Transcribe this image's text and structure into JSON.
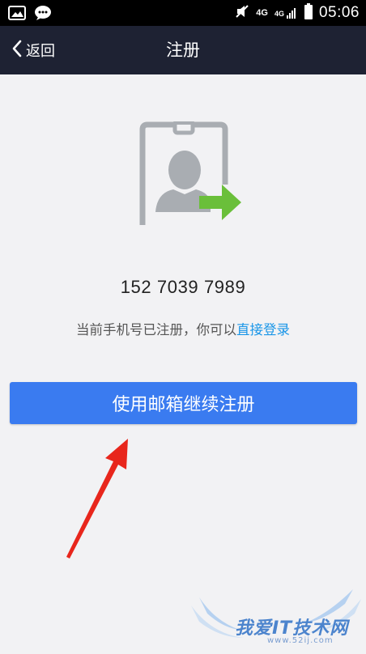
{
  "status_bar": {
    "time": "05:06",
    "network_1": "4G",
    "network_2": "4G",
    "icons": [
      "gallery-icon",
      "chat-bubble-icon",
      "mute-icon",
      "signal-icon",
      "battery-icon"
    ]
  },
  "header": {
    "back_label": "返回",
    "title": "注册"
  },
  "main": {
    "phone_number": "152 7039 7989",
    "hint_prefix": "当前手机号已注册，你可以",
    "hint_link": "直接登录",
    "continue_button": "使用邮箱继续注册"
  },
  "watermark": {
    "text": "我爱IT技术网",
    "url": "www.52ij.com"
  },
  "colors": {
    "header_bg": "#1e2233",
    "page_bg": "#f2f2f4",
    "primary_button": "#3a7bf0",
    "link": "#1a96e8",
    "illustration_gray": "#a9adb2",
    "illustration_green": "#6abf3a",
    "annotation_arrow": "#e8261c"
  }
}
